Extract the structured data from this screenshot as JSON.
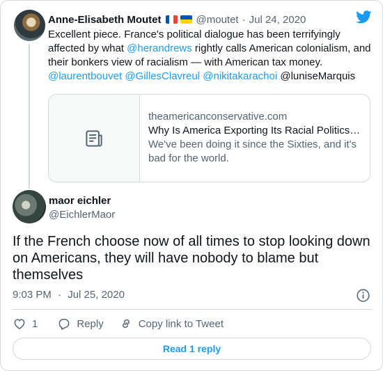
{
  "parent_tweet": {
    "author_name": "Anne-Elisabeth Moutet",
    "flags": [
      "france-flag",
      "ukraine-flag"
    ],
    "handle": "@moutet",
    "separator": "·",
    "date": "Jul 24, 2020",
    "text": {
      "part1": "Excellent piece. France's political dialogue has been terrifyingly affected by what ",
      "mention_herandrews": "@herandrews",
      "part2": " rightly calls American colonialism, and their bonkers view of racialism — with American tax money.",
      "mention_laurentbouvet": "@laurentbouvet",
      "mention_gillesclavreul": "@GillesClavreul",
      "mention_nikitakarachoi": "@nikitakarachoi",
      "plain_mention": "@luniseMarquis"
    },
    "link_card": {
      "icon": "article-icon",
      "domain": "theamericanconservative.com",
      "title": "Why Is America Exporting Its Racial Politics…",
      "description": "We've been doing it since the Sixties, and it's bad for the world."
    }
  },
  "main_tweet": {
    "author_name": "maor eichler",
    "handle": "@EichlerMaor",
    "text": "If the French choose now of all times to stop looking down on Americans, they will have nobody to blame but themselves",
    "time": "9:03 PM",
    "separator": "·",
    "date": "Jul 25, 2020"
  },
  "actions": {
    "like_count": "1",
    "reply_label": "Reply",
    "copy_link_label": "Copy link to Tweet"
  },
  "read_replies_label": "Read 1 reply",
  "colors": {
    "accent": "#1d9bf0",
    "text": "#0f1419",
    "muted": "#536471",
    "border": "#cfd9de"
  },
  "icons": [
    "twitter-bird-icon",
    "article-icon",
    "info-icon",
    "heart-icon",
    "reply-icon",
    "link-icon"
  ]
}
